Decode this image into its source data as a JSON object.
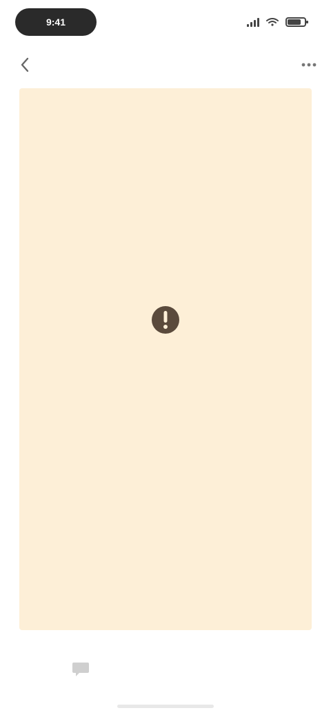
{
  "status_bar": {
    "time": "9:41"
  },
  "nav": {
    "back_icon": "chevron-left-icon",
    "title": "",
    "more_icon": "ellipsis-icon"
  },
  "content": {
    "background": "#fdefd7",
    "icon": "warning-icon",
    "message": "",
    "footer_link": ""
  },
  "bottom": {
    "icon": "message-icon",
    "text": ""
  }
}
